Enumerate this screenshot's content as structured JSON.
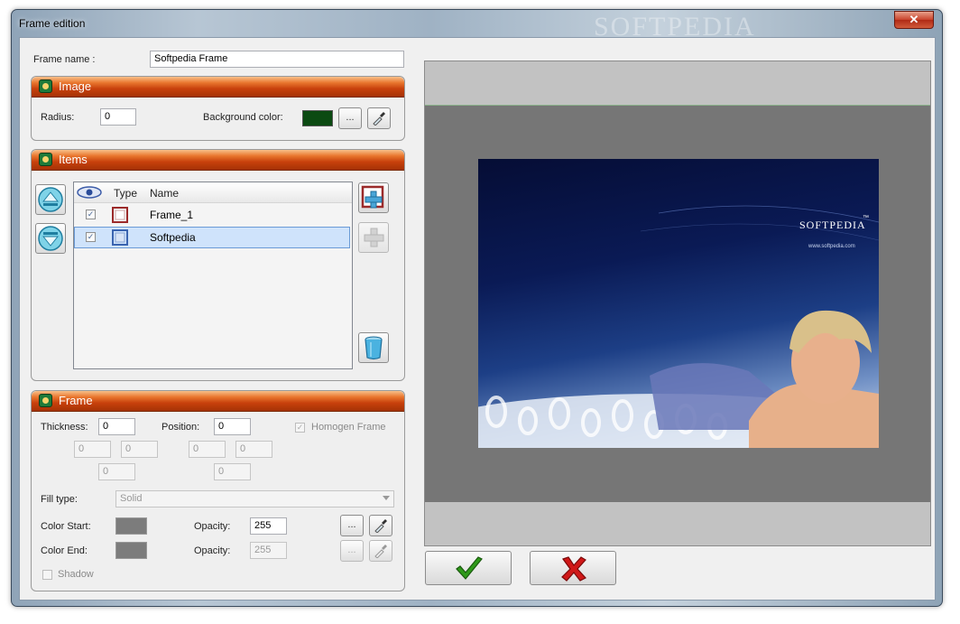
{
  "window": {
    "title": "Frame edition",
    "watermark": "SOFTPEDIA",
    "close_glyph": "✕"
  },
  "frame_name": {
    "label": "Frame name :",
    "value": "Softpedia Frame"
  },
  "image_panel": {
    "title": "Image",
    "radius_label": "Radius:",
    "radius_value": "0",
    "bg_color_label": "Background color:",
    "bg_color": "#0b4a12",
    "browse_label": "..."
  },
  "items_panel": {
    "title": "Items",
    "columns": {
      "visible_icon": "eye-icon",
      "type": "Type",
      "name": "Name"
    },
    "rows": [
      {
        "checked": "✓",
        "name": "Frame_1",
        "type_color": "#9b2a2a"
      },
      {
        "checked": "✓",
        "name": "Softpedia",
        "type_color": "#3a64b0"
      }
    ]
  },
  "frame_panel": {
    "title": "Frame",
    "thickness_label": "Thickness:",
    "thickness_value": "0",
    "thickness_sub": [
      "0",
      "0",
      "0"
    ],
    "position_label": "Position:",
    "position_value": "0",
    "position_sub": [
      "0",
      "0",
      "0"
    ],
    "homogen_label": "Homogen Frame",
    "homogen_checked": "✓",
    "fill_type_label": "Fill type:",
    "fill_type_value": "Solid",
    "color_start_label": "Color Start:",
    "color_start": "#7c7c7c",
    "opacity1_label": "Opacity:",
    "opacity1_value": "255",
    "color_end_label": "Color End:",
    "color_end": "#7c7c7c",
    "opacity2_label": "Opacity:",
    "opacity2_value": "255",
    "shadow_label": "Shadow",
    "browse_label": "..."
  },
  "preview": {
    "brand": "SOFTPEDIA",
    "tm": "™",
    "url": "www.softpedia.com"
  },
  "colors": {
    "ok_green": "#2f9a1a",
    "cancel_red": "#d01818",
    "header_orange": "#d9541a"
  }
}
